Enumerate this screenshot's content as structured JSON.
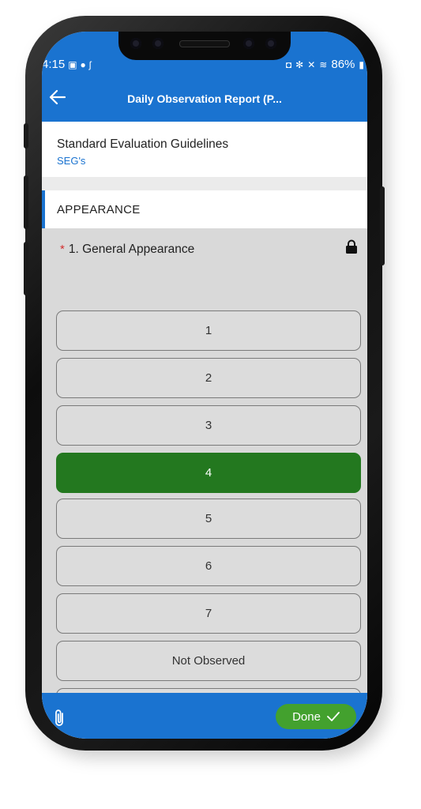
{
  "status_bar": {
    "time": "4:15",
    "battery": "86%"
  },
  "app_bar": {
    "title": "Daily Observation Report (P..."
  },
  "guidelines": {
    "title": "Standard Evaluation Guidelines",
    "link": "SEG's"
  },
  "section": {
    "label": "APPEARANCE"
  },
  "question": {
    "required_mark": "*",
    "label": "1.  General Appearance"
  },
  "options": [
    {
      "label": "1",
      "selected": false
    },
    {
      "label": "2",
      "selected": false
    },
    {
      "label": "3",
      "selected": false
    },
    {
      "label": "4",
      "selected": true
    },
    {
      "label": "5",
      "selected": false
    },
    {
      "label": "6",
      "selected": false
    },
    {
      "label": "7",
      "selected": false
    },
    {
      "label": "Not Observed",
      "selected": false
    }
  ],
  "bottom_bar": {
    "done_label": "Done"
  },
  "colors": {
    "primary": "#1a73d0",
    "selected_option": "#23781f",
    "done_button": "#43a12e",
    "required": "#d32f2f"
  }
}
